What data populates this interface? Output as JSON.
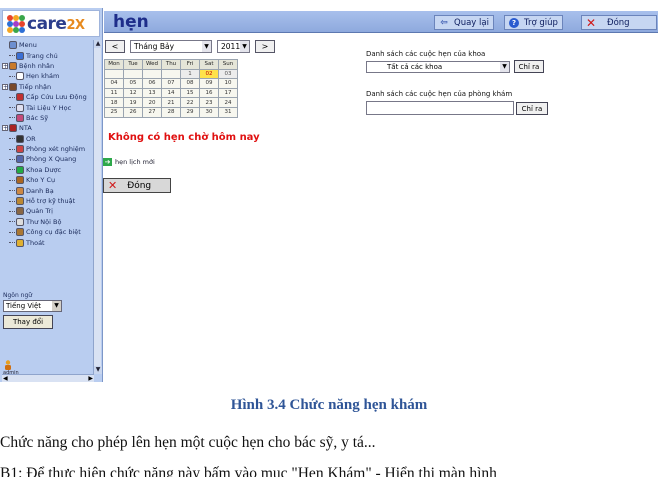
{
  "app": {
    "logo": "care",
    "logo_suffix": "2X"
  },
  "header": {
    "title": "hẹn",
    "back_label": "Quay lại",
    "help_label": "Trợ giúp",
    "close_label": "Đóng"
  },
  "sidebar": {
    "items": [
      {
        "label": "Menu",
        "icon": "menu-icon",
        "color": "#6d8fd0",
        "level": 0,
        "expand": ""
      },
      {
        "label": "Trang chủ",
        "icon": "home-icon",
        "color": "#3b6fd4",
        "level": 1,
        "expand": ""
      },
      {
        "label": "Bệnh nhân",
        "icon": "patient-icon",
        "color": "#c87a2a",
        "level": 0,
        "expand": "+"
      },
      {
        "label": "Hẹn khám",
        "icon": "appointment-icon",
        "color": "#ffffff",
        "level": 1,
        "expand": ""
      },
      {
        "label": "Tiếp nhận",
        "icon": "admission-icon",
        "color": "#7a4a2a",
        "level": 0,
        "expand": "+"
      },
      {
        "label": "Cấp Cứu Lưu Động",
        "icon": "ambulance-icon",
        "color": "#c03030",
        "level": 1,
        "expand": ""
      },
      {
        "label": "Tài Liệu Y Học",
        "icon": "medocs-icon",
        "color": "#e0e0f0",
        "level": 1,
        "expand": ""
      },
      {
        "label": "Bác Sỹ",
        "icon": "doctor-icon",
        "color": "#c44a7a",
        "level": 1,
        "expand": ""
      },
      {
        "label": "NTA",
        "icon": "nursing-icon",
        "color": "#aa2222",
        "level": 0,
        "expand": "+"
      },
      {
        "label": "OR",
        "icon": "or-icon",
        "color": "#333333",
        "level": 1,
        "expand": ""
      },
      {
        "label": "Phòng xét nghiệm",
        "icon": "lab-icon",
        "color": "#cc4444",
        "level": 1,
        "expand": ""
      },
      {
        "label": "Phòng X Quang",
        "icon": "radiology-icon",
        "color": "#5566aa",
        "level": 1,
        "expand": ""
      },
      {
        "label": "Khoa Dược",
        "icon": "pharmacy-icon",
        "color": "#22aa44",
        "level": 1,
        "expand": ""
      },
      {
        "label": "Kho Y Cụ",
        "icon": "supply-icon",
        "color": "#aa6622",
        "level": 1,
        "expand": ""
      },
      {
        "label": "Danh Bạ",
        "icon": "directory-icon",
        "color": "#cc8844",
        "level": 1,
        "expand": ""
      },
      {
        "label": "Hỗ trợ kỹ thuật",
        "icon": "tech-support-icon",
        "color": "#bb8833",
        "level": 1,
        "expand": ""
      },
      {
        "label": "Quản Trị",
        "icon": "admin-icon",
        "color": "#886644",
        "level": 1,
        "expand": ""
      },
      {
        "label": "Thư Nội Bộ",
        "icon": "mail-icon",
        "color": "#dddddd",
        "level": 1,
        "expand": ""
      },
      {
        "label": "Công cụ đặc biệt",
        "icon": "special-tools-icon",
        "color": "#aa7733",
        "level": 1,
        "expand": ""
      },
      {
        "label": "Thoát",
        "icon": "logout-icon",
        "color": "#e0b030",
        "level": 1,
        "expand": ""
      }
    ],
    "lang_label": "Ngôn ngữ",
    "lang_value": "Tiếng Việt",
    "lang_button": "Thay đổi",
    "user_label": "admin"
  },
  "calendar": {
    "month": "Tháng Bảy",
    "year": "2011",
    "prev": "<",
    "next": ">",
    "weekdays": [
      "Mon",
      "Tue",
      "Wed",
      "Thu",
      "Fri",
      "Sat",
      "Sun"
    ],
    "weeks": [
      [
        "",
        "",
        "",
        "",
        "1",
        "02",
        "03"
      ],
      [
        "04",
        "05",
        "06",
        "07",
        "08",
        "09",
        "10"
      ],
      [
        "11",
        "12",
        "13",
        "14",
        "15",
        "16",
        "17"
      ],
      [
        "18",
        "19",
        "20",
        "21",
        "22",
        "23",
        "24"
      ],
      [
        "25",
        "26",
        "27",
        "28",
        "29",
        "30",
        "31"
      ]
    ],
    "today": "02"
  },
  "main": {
    "no_appointments": "Không có hẹn chờ hôm nay",
    "new_appointment": "hẹn lịch mới",
    "close_label": "Đóng"
  },
  "right_panel": {
    "dept_label": "Danh sách các cuộc hẹn của khoa",
    "dept_value": "Tất cả các khoa",
    "dept_button": "Chỉ ra",
    "clinic_label": "Danh sách các cuộc hẹn của phòng khám",
    "clinic_value": "",
    "clinic_button": "Chỉ ra"
  },
  "document": {
    "caption": "Hình 3.4   Chức năng hẹn khám",
    "para1": "Chức năng cho phép lên hẹn một cuộc hẹn cho bác sỹ, y tá...",
    "para2": "B1: Để thực hiện chức năng này bấm vào mục \"Hẹn Khám\" - Hiển thị màn hình"
  }
}
